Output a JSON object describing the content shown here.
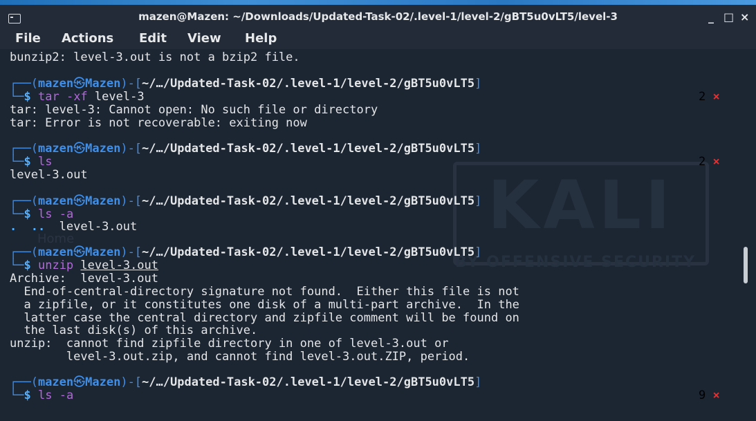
{
  "window": {
    "title": "mazen@Mazen: ~/Downloads/Updated-Task-02/.level-1/level-2/gBT5u0vLT5/level-3",
    "minimize": "_",
    "maximize": "□",
    "close": "×"
  },
  "menu": [
    "File",
    "Actions",
    "Edit",
    "View",
    "Help"
  ],
  "watermark": {
    "text": "KALI",
    "sub": "BY OFFENSIVE SECURITY",
    "home": "Home"
  },
  "prompt": {
    "bracket_open": "┌──(",
    "user": "mazen",
    "at": "㉿",
    "host": "Mazen",
    "mid": ")-[",
    "path": "~/…/Updated-Task-02/.level-1/level-2/gBT5u0vLT5",
    "bracket_close": "]",
    "dollar_prefix": "└─",
    "dollar": "$"
  },
  "terminal": {
    "line0": "bunzip2: level-3.out is not a bzip2 file.",
    "cmd1_name": "tar",
    "cmd1_flag": "-xf",
    "cmd1_arg": "level-3",
    "cmd1_status": "2",
    "out1_a": "tar: level-3: Cannot open: No such file or directory",
    "out1_b": "tar: Error is not recoverable: exiting now",
    "cmd2_name": "ls",
    "cmd2_status": "2",
    "out2": "level-3.out",
    "cmd3_name": "ls",
    "cmd3_flag": "-a",
    "out3_dots": ".  ..",
    "out3_file": "  level-3.out",
    "cmd4_name": "unzip",
    "cmd4_arg": "level-3.out",
    "out4_1": "Archive:  level-3.out",
    "out4_2": "  End-of-central-directory signature not found.  Either this file is not",
    "out4_3": "  a zipfile, or it constitutes one disk of a multi-part archive.  In the",
    "out4_4": "  latter case the central directory and zipfile comment will be found on",
    "out4_5": "  the last disk(s) of this archive.",
    "out4_6": "unzip:  cannot find zipfile directory in one of level-3.out or",
    "out4_7": "        level-3.out.zip, and cannot find level-3.out.ZIP, period.",
    "cmd5_name": "ls",
    "cmd5_flag": "-a",
    "cmd5_status": "9",
    "status_x": "×"
  }
}
